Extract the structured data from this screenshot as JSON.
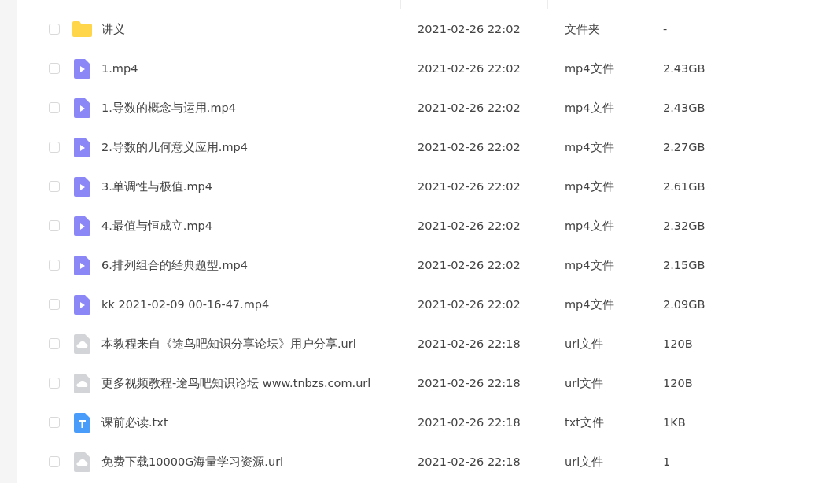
{
  "files": [
    {
      "kind": "folder",
      "name": "讲义",
      "checked": false,
      "modified": "2021-02-26 22:02",
      "type": "文件夹",
      "size": "-"
    },
    {
      "kind": "video",
      "name": "1.mp4",
      "checked": false,
      "modified": "2021-02-26 22:02",
      "type": "mp4文件",
      "size": "2.43GB"
    },
    {
      "kind": "video",
      "name": "1.导数的概念与运用.mp4",
      "checked": false,
      "modified": "2021-02-26 22:02",
      "type": "mp4文件",
      "size": "2.43GB"
    },
    {
      "kind": "video",
      "name": "2.导数的几何意义应用.mp4",
      "checked": false,
      "modified": "2021-02-26 22:02",
      "type": "mp4文件",
      "size": "2.27GB"
    },
    {
      "kind": "video",
      "name": "3.单调性与极值.mp4",
      "checked": false,
      "modified": "2021-02-26 22:02",
      "type": "mp4文件",
      "size": "2.61GB"
    },
    {
      "kind": "video",
      "name": "4.最值与恒成立.mp4",
      "checked": false,
      "modified": "2021-02-26 22:02",
      "type": "mp4文件",
      "size": "2.32GB"
    },
    {
      "kind": "video",
      "name": "6.排列组合的经典题型.mp4",
      "checked": false,
      "modified": "2021-02-26 22:02",
      "type": "mp4文件",
      "size": "2.15GB"
    },
    {
      "kind": "video",
      "name": "kk 2021-02-09 00-16-47.mp4",
      "checked": false,
      "modified": "2021-02-26 22:02",
      "type": "mp4文件",
      "size": "2.09GB"
    },
    {
      "kind": "link",
      "name": "本教程来自《途鸟吧知识分享论坛》用户分享.url",
      "checked": false,
      "modified": "2021-02-26 22:18",
      "type": "url文件",
      "size": "120B"
    },
    {
      "kind": "link",
      "name": "更多视频教程-途鸟吧知识论坛 www.tnbzs.com.url",
      "checked": false,
      "modified": "2021-02-26 22:18",
      "type": "url文件",
      "size": "120B"
    },
    {
      "kind": "text",
      "name": "课前必读.txt",
      "checked": false,
      "modified": "2021-02-26 22:18",
      "type": "txt文件",
      "size": "1KB"
    },
    {
      "kind": "link",
      "name": "免费下载10000G海量学习资源.url",
      "checked": false,
      "modified": "2021-02-26 22:18",
      "type": "url文件",
      "size": "1"
    }
  ]
}
